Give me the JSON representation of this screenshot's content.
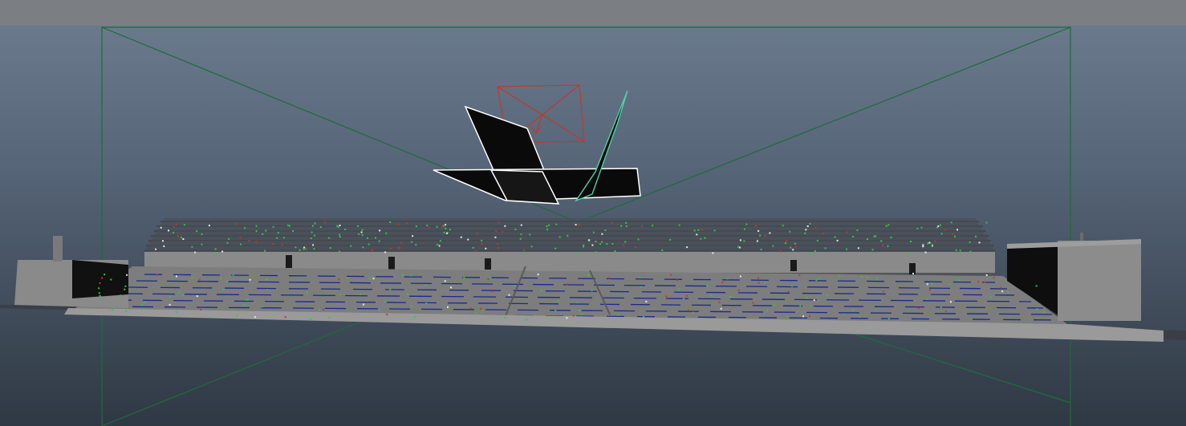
{
  "viewport": {
    "background_top": "#6a7a8c",
    "background_bottom": "#2f3944",
    "camera_frame_color": "#1f6b3a",
    "selection_color": "#ffffff",
    "light_gizmo_color": "#c0392b",
    "highlight_color": "#4fd1a7",
    "stadium_gray": "#8a8a8a",
    "seat_blue": "#1a2a8c"
  },
  "objects": {
    "camera_frame": "camera-view-frustum",
    "light": "area-light-gizmo",
    "selected_planes": "selected-polygon-planes",
    "stadium": "stadium-model"
  }
}
